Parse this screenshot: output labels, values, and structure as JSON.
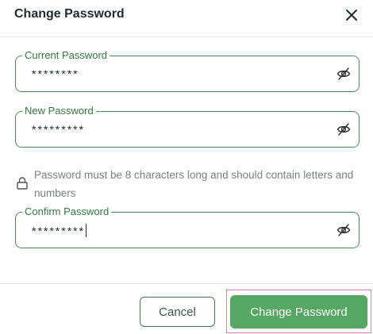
{
  "dialog": {
    "title": "Change Password",
    "close_icon": "close-icon"
  },
  "fields": {
    "current": {
      "label": "Current Password",
      "value": "********",
      "icon": "eye-off-icon"
    },
    "new": {
      "label": "New Password",
      "value": "*********",
      "icon": "eye-off-icon"
    },
    "confirm": {
      "label": "Confirm Password",
      "value": "*********",
      "icon": "eye-off-icon"
    }
  },
  "hint": {
    "icon": "lock-icon",
    "text": "Password must be 8 characters long and should contain letters and numbers"
  },
  "buttons": {
    "cancel_label": "Cancel",
    "submit_label": "Change Password"
  },
  "colors": {
    "accent": "#56a763",
    "label_green": "#2e7d3e",
    "border_green": "#4a8a56",
    "hint_gray": "#7a8185"
  }
}
